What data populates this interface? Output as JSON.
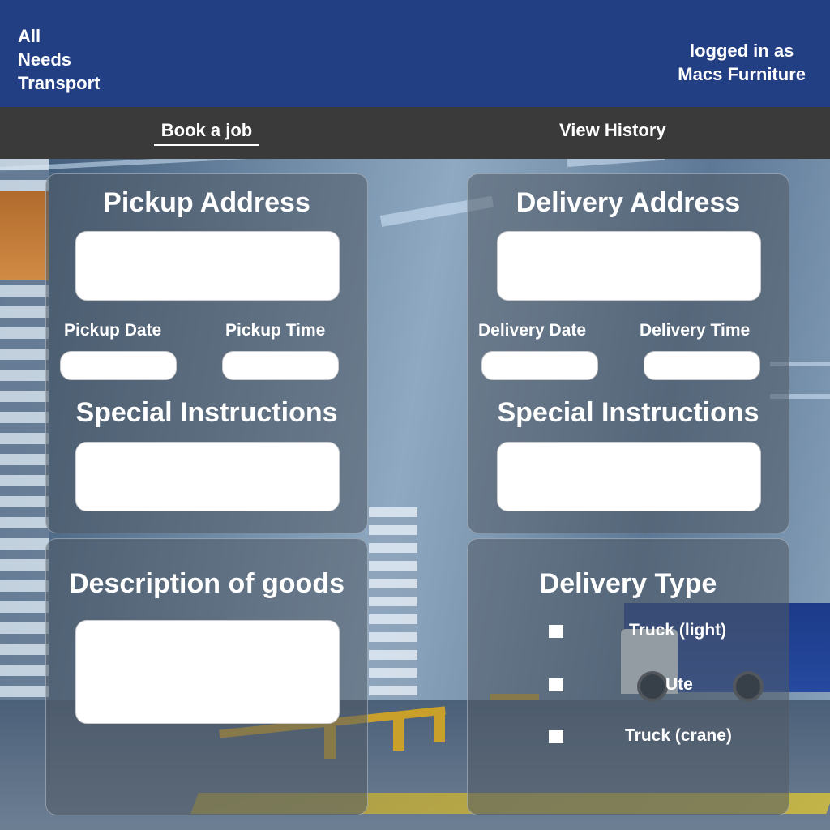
{
  "header": {
    "brand": "All\nNeeds\nTransport",
    "login_line1": "logged in as",
    "login_line2": "Macs Furniture",
    "color": "#233f84"
  },
  "nav": {
    "book": "Book a job",
    "history": "View History",
    "active": "Book a job"
  },
  "pickup": {
    "title": "Pickup Address",
    "address_value": "",
    "date_label": "Pickup Date",
    "date_value": "",
    "time_label": "Pickup Time",
    "time_value": "",
    "instructions_title": "Special Instructions",
    "instructions_value": ""
  },
  "delivery": {
    "title": "Delivery Address",
    "address_value": "",
    "date_label": "Delivery Date",
    "date_value": "",
    "time_label": "Delivery Time",
    "time_value": "",
    "instructions_title": "Special Instructions",
    "instructions_value": ""
  },
  "goods": {
    "title": "Description of goods",
    "value": ""
  },
  "delivery_type": {
    "title": "Delivery Type",
    "options": [
      {
        "label": "Truck (light)",
        "checked": false
      },
      {
        "label": "Ute",
        "checked": false
      },
      {
        "label": "Truck (crane)",
        "checked": false
      }
    ]
  }
}
